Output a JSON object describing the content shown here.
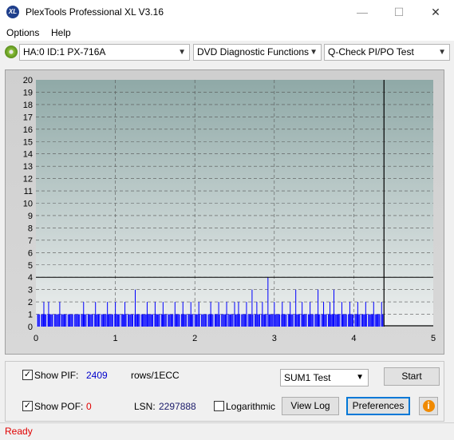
{
  "window": {
    "title": "PlexTools Professional XL V3.16",
    "icon_text": "XL"
  },
  "menu": [
    "Options",
    "Help"
  ],
  "toolbar": {
    "drive": "HA:0 ID:1  PX-716A",
    "function": "DVD Diagnostic Functions",
    "test": "Q-Check PI/PO Test"
  },
  "chart_data": {
    "type": "bar",
    "x_ticks": [
      "0",
      "1",
      "2",
      "3",
      "4",
      "5"
    ],
    "y_ticks": [
      "0",
      "1",
      "2",
      "3",
      "4",
      "5",
      "6",
      "7",
      "8",
      "9",
      "10",
      "11",
      "12",
      "13",
      "14",
      "15",
      "16",
      "17",
      "18",
      "19",
      "20"
    ],
    "xlim": [
      0,
      5
    ],
    "ylim": [
      0,
      20
    ],
    "threshold": 4,
    "end_marker_x": 4.38,
    "series": [
      {
        "color": "#0000ff",
        "x": [
          0.1,
          0.16,
          0.3,
          0.6,
          0.75,
          0.9,
          1.0,
          1.12,
          1.25,
          1.4,
          1.5,
          1.6,
          1.75,
          1.85,
          1.95,
          2.05,
          2.2,
          2.3,
          2.4,
          2.5,
          2.55,
          2.65,
          2.72,
          2.78,
          2.85,
          2.92,
          3.0,
          3.1,
          3.2,
          3.27,
          3.35,
          3.45,
          3.55,
          3.62,
          3.7,
          3.75,
          3.85,
          3.95,
          4.05,
          4.15,
          4.25,
          4.35
        ],
        "values": [
          2,
          2,
          2,
          2,
          2,
          2,
          2,
          2,
          3,
          2,
          2,
          2,
          2,
          2,
          2,
          2,
          2,
          2,
          2,
          2,
          2,
          2,
          3,
          2,
          2,
          4,
          2,
          2,
          2,
          3,
          2,
          2,
          3,
          2,
          2,
          3,
          2,
          2,
          2,
          2,
          2,
          2
        ]
      }
    ],
    "grid": true
  },
  "bottom": {
    "show_pif": "Show PIF:",
    "pif_value": "2409",
    "rows_label": "rows/1ECC",
    "show_pof": "Show POF:",
    "pof_value": "0",
    "lsn_label": "LSN:",
    "lsn_value": "2297888",
    "logarithmic": "Logarithmic",
    "sum_select": "SUM1 Test",
    "start": "Start",
    "view_log": "View Log",
    "preferences": "Preferences"
  },
  "status": "Ready",
  "colors": {
    "pif": "#0000cc",
    "pof": "#e00000",
    "status": "#e00000"
  }
}
